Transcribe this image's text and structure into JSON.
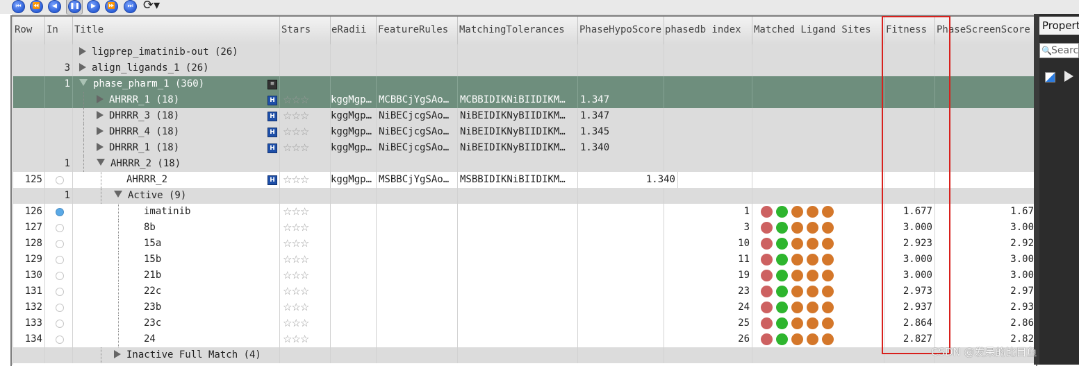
{
  "columns": {
    "row": "Row",
    "in": "In",
    "title": "Title",
    "stars": "Stars",
    "radii": "eRadii",
    "feature_rules": "FeatureRules",
    "matching_tolerances": "MatchingTolerances",
    "phase_hypo_score": "PhaseHypoScore",
    "phasedb_index": "phasedb index",
    "matched_ligand_sites": "Matched Ligand Sites",
    "fitness": "Fitness",
    "phase_screen_score": "PhaseScreenScore"
  },
  "colors": {
    "selected_row": "#6e8e7d",
    "site_red": "#cd6161",
    "site_green": "#2eb52e",
    "site_orange": "#d4772a",
    "highlight_box": "#d8201c"
  },
  "rows": [
    {
      "kind": "group",
      "title": "ligprep_imatinib-out (26)",
      "in": "",
      "expanded": false,
      "indent": 0
    },
    {
      "kind": "group",
      "title": "align_ligands_1 (26)",
      "in": "3",
      "expanded": false,
      "indent": 0
    },
    {
      "kind": "group",
      "title": "phase_pharm_1 (360)",
      "in": "1",
      "expanded": true,
      "indent": 0,
      "selected": true,
      "icon": "menu-icon"
    },
    {
      "kind": "hypo",
      "title": "AHRRR_1 (18)",
      "selected": true,
      "expanded": false,
      "stars": "☆☆☆",
      "radii": "kggMgp…",
      "feature_rules": "MCBBCjYgSAo…",
      "matching_tolerances": "MCBBIDIKNiBIIDIKM…",
      "phase_hypo_score": "1.347",
      "indent": 1
    },
    {
      "kind": "hypo",
      "title": "DHRRR_3 (18)",
      "expanded": false,
      "stars": "☆☆☆",
      "radii": "kggMgp…",
      "feature_rules": "NiBECjcgSAo…",
      "matching_tolerances": "NiBEIDIKNyBIIDIKM…",
      "phase_hypo_score": "1.347",
      "indent": 1
    },
    {
      "kind": "hypo",
      "title": "DHRRR_4 (18)",
      "expanded": false,
      "stars": "☆☆☆",
      "radii": "kggMgp…",
      "feature_rules": "NiBECjcgSAo…",
      "matching_tolerances": "NiBEIDIKNyBIIDIKM…",
      "phase_hypo_score": "1.345",
      "indent": 1
    },
    {
      "kind": "hypo",
      "title": "DHRRR_1 (18)",
      "expanded": false,
      "stars": "☆☆☆",
      "radii": "kggMgp…",
      "feature_rules": "NiBECjcgSAo…",
      "matching_tolerances": "NiBEIDIKNyBIIDIKM…",
      "phase_hypo_score": "1.340",
      "indent": 1
    },
    {
      "kind": "group",
      "title": "AHRRR_2 (18)",
      "in": "1",
      "expanded": true,
      "indent": 1
    },
    {
      "kind": "entry",
      "row": "125",
      "title": "AHRRR_2",
      "stars": "☆☆☆",
      "radii": "kggMgp…",
      "feature_rules": "MSBBCjYgSAo…",
      "matching_tolerances": "MSBBIDIKNiBIIDIKM…",
      "phase_hypo_score": "1.340",
      "hypo_icon": true,
      "indent": 2
    },
    {
      "kind": "group",
      "title": "Active (9)",
      "in": "1",
      "expanded": true,
      "indent": 2
    },
    {
      "kind": "ligand",
      "row": "126",
      "title": "imatinib",
      "stars": "☆☆☆",
      "phasedb_index": "1",
      "fitness": "1.677",
      "screen": "1.67",
      "radio_on": true,
      "indent": 3
    },
    {
      "kind": "ligand",
      "row": "127",
      "title": "8b",
      "stars": "☆☆☆",
      "phasedb_index": "3",
      "fitness": "3.000",
      "screen": "3.00",
      "indent": 3
    },
    {
      "kind": "ligand",
      "row": "128",
      "title": "15a",
      "stars": "☆☆☆",
      "phasedb_index": "10",
      "fitness": "2.923",
      "screen": "2.92",
      "indent": 3
    },
    {
      "kind": "ligand",
      "row": "129",
      "title": "15b",
      "stars": "☆☆☆",
      "phasedb_index": "11",
      "fitness": "3.000",
      "screen": "3.00",
      "indent": 3
    },
    {
      "kind": "ligand",
      "row": "130",
      "title": "21b",
      "stars": "☆☆☆",
      "phasedb_index": "19",
      "fitness": "3.000",
      "screen": "3.00",
      "indent": 3
    },
    {
      "kind": "ligand",
      "row": "131",
      "title": "22c",
      "stars": "☆☆☆",
      "phasedb_index": "23",
      "fitness": "2.973",
      "screen": "2.97",
      "indent": 3
    },
    {
      "kind": "ligand",
      "row": "132",
      "title": "23b",
      "stars": "☆☆☆",
      "phasedb_index": "24",
      "fitness": "2.937",
      "screen": "2.93",
      "indent": 3
    },
    {
      "kind": "ligand",
      "row": "133",
      "title": "23c",
      "stars": "☆☆☆",
      "phasedb_index": "25",
      "fitness": "2.864",
      "screen": "2.86",
      "indent": 3
    },
    {
      "kind": "ligand",
      "row": "134",
      "title": "24",
      "stars": "☆☆☆",
      "phasedb_index": "26",
      "fitness": "2.827",
      "screen": "2.82",
      "indent": 3
    },
    {
      "kind": "group",
      "title": "Inactive Full Match (4)",
      "in": "",
      "expanded": false,
      "indent": 2
    }
  ],
  "matched_sites": [
    "site_red",
    "site_green",
    "site_orange",
    "site_orange",
    "site_orange"
  ],
  "right_panel": {
    "tab_label": "Propert",
    "search_placeholder": "Searc"
  },
  "watermark": "CSDN @发呆的比目鱼"
}
